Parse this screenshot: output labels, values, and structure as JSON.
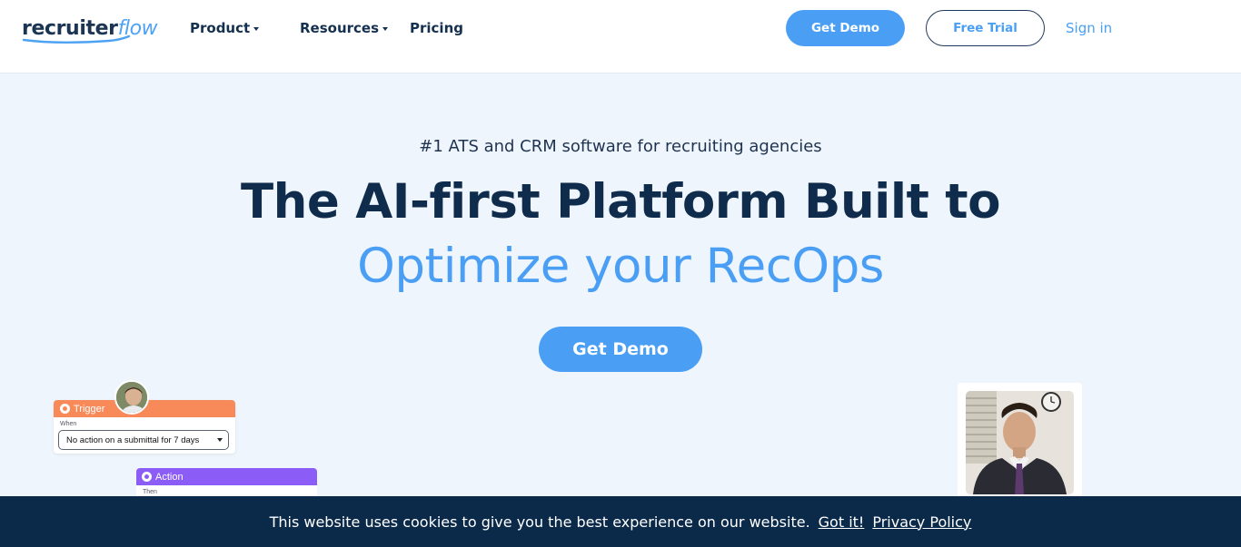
{
  "header": {
    "logo": {
      "part1": "recruiter",
      "part2": "flow"
    },
    "nav": [
      {
        "label": "Product",
        "has_dropdown": true
      },
      {
        "label": "Resources",
        "has_dropdown": true
      },
      {
        "label": "Pricing",
        "has_dropdown": false
      }
    ],
    "get_demo_label": "Get Demo",
    "free_trial_label": "Free Trial",
    "sign_in_label": "Sign in"
  },
  "hero": {
    "tagline": "#1 ATS and CRM software for recruiting agencies",
    "title_line1": "The AI-first Platform Built to",
    "title_line2": "Optimize your RecOps",
    "cta_label": "Get Demo"
  },
  "workflow": {
    "trigger_label": "Trigger",
    "when_label": "When",
    "trigger_value": "No action on a submittal for 7 days",
    "action_label": "Action",
    "then_label": "Then"
  },
  "cookie_bar": {
    "message": "This website uses cookies to give you the best experience on our website.",
    "accept_label": "Got it!",
    "policy_label": "Privacy Policy"
  },
  "colors": {
    "brand_blue": "#4a9ff5",
    "navy": "#102c4c",
    "trigger_orange": "#f88a5a",
    "action_purple": "#8b5cf6",
    "cookie_bg": "#0b2a4a",
    "hero_bg": "#eef5fd"
  }
}
